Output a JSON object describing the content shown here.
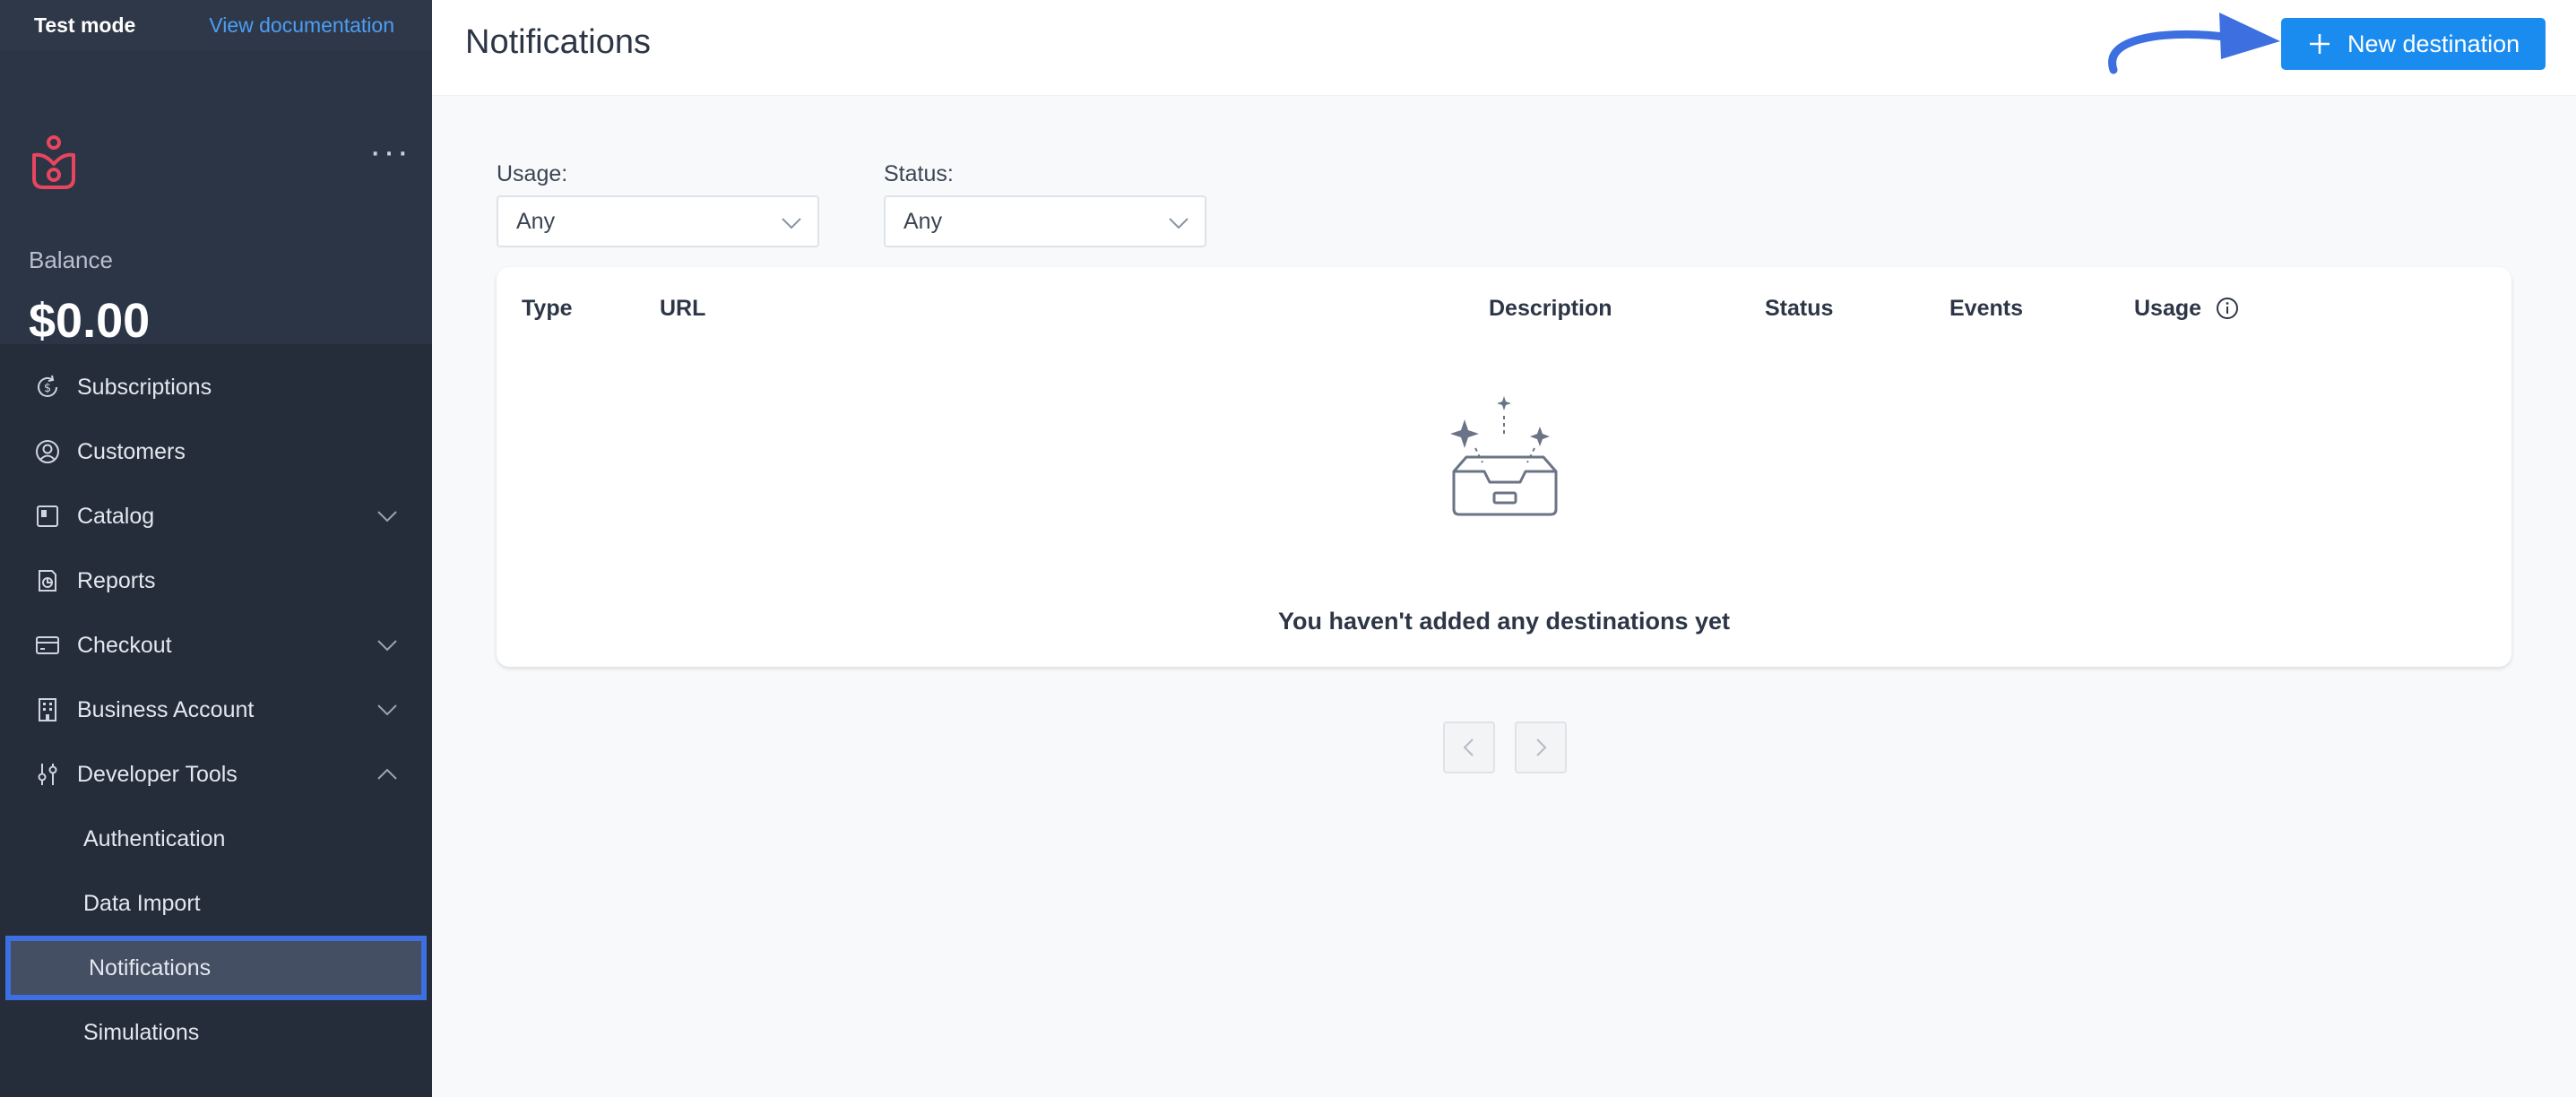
{
  "topbar": {
    "mode": "Test mode",
    "docs_link": "View documentation"
  },
  "balance": {
    "label": "Balance",
    "value": "$0.00"
  },
  "nav": {
    "subscriptions": "Subscriptions",
    "customers": "Customers",
    "catalog": "Catalog",
    "reports": "Reports",
    "checkout": "Checkout",
    "business_account": "Business Account",
    "developer_tools": "Developer Tools",
    "authentication": "Authentication",
    "data_import": "Data Import",
    "notifications": "Notifications",
    "simulations": "Simulations"
  },
  "header": {
    "title": "Notifications",
    "new_button": "New destination"
  },
  "filters": {
    "usage": {
      "label": "Usage:",
      "value": "Any"
    },
    "status": {
      "label": "Status:",
      "value": "Any"
    }
  },
  "table": {
    "columns": [
      "Type",
      "URL",
      "Description",
      "Status",
      "Events",
      "Usage"
    ],
    "empty_message": "You haven't added any destinations yet"
  },
  "colors": {
    "accent": "#1a8cf0",
    "sidebar": "#252d3b",
    "highlight": "#3d6fe0",
    "logo": "#e8455f"
  }
}
